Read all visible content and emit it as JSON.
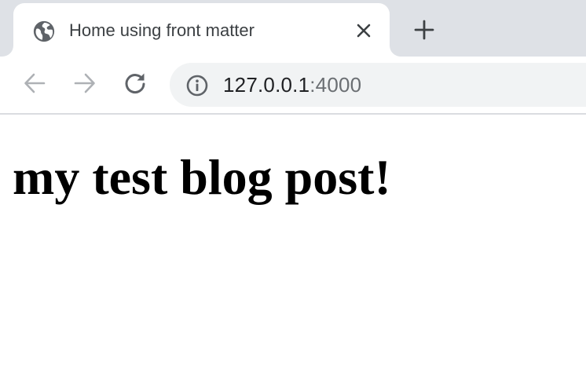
{
  "tab": {
    "title": "Home using front matter",
    "favicon_icon": "globe-icon",
    "close_icon": "close-icon"
  },
  "new_tab_icon": "plus-icon",
  "toolbar": {
    "back_icon": "arrow-left-icon",
    "forward_icon": "arrow-right-icon",
    "reload_icon": "reload-icon",
    "site_info_icon": "info-icon",
    "url_host": "127.0.0.1",
    "url_port": ":4000"
  },
  "page": {
    "heading": "my test blog post!"
  },
  "colors": {
    "tab_strip": "#dee1e6",
    "omnibox": "#f1f3f4",
    "icon_active": "#5f6368",
    "icon_disabled": "#aeb1b5"
  }
}
